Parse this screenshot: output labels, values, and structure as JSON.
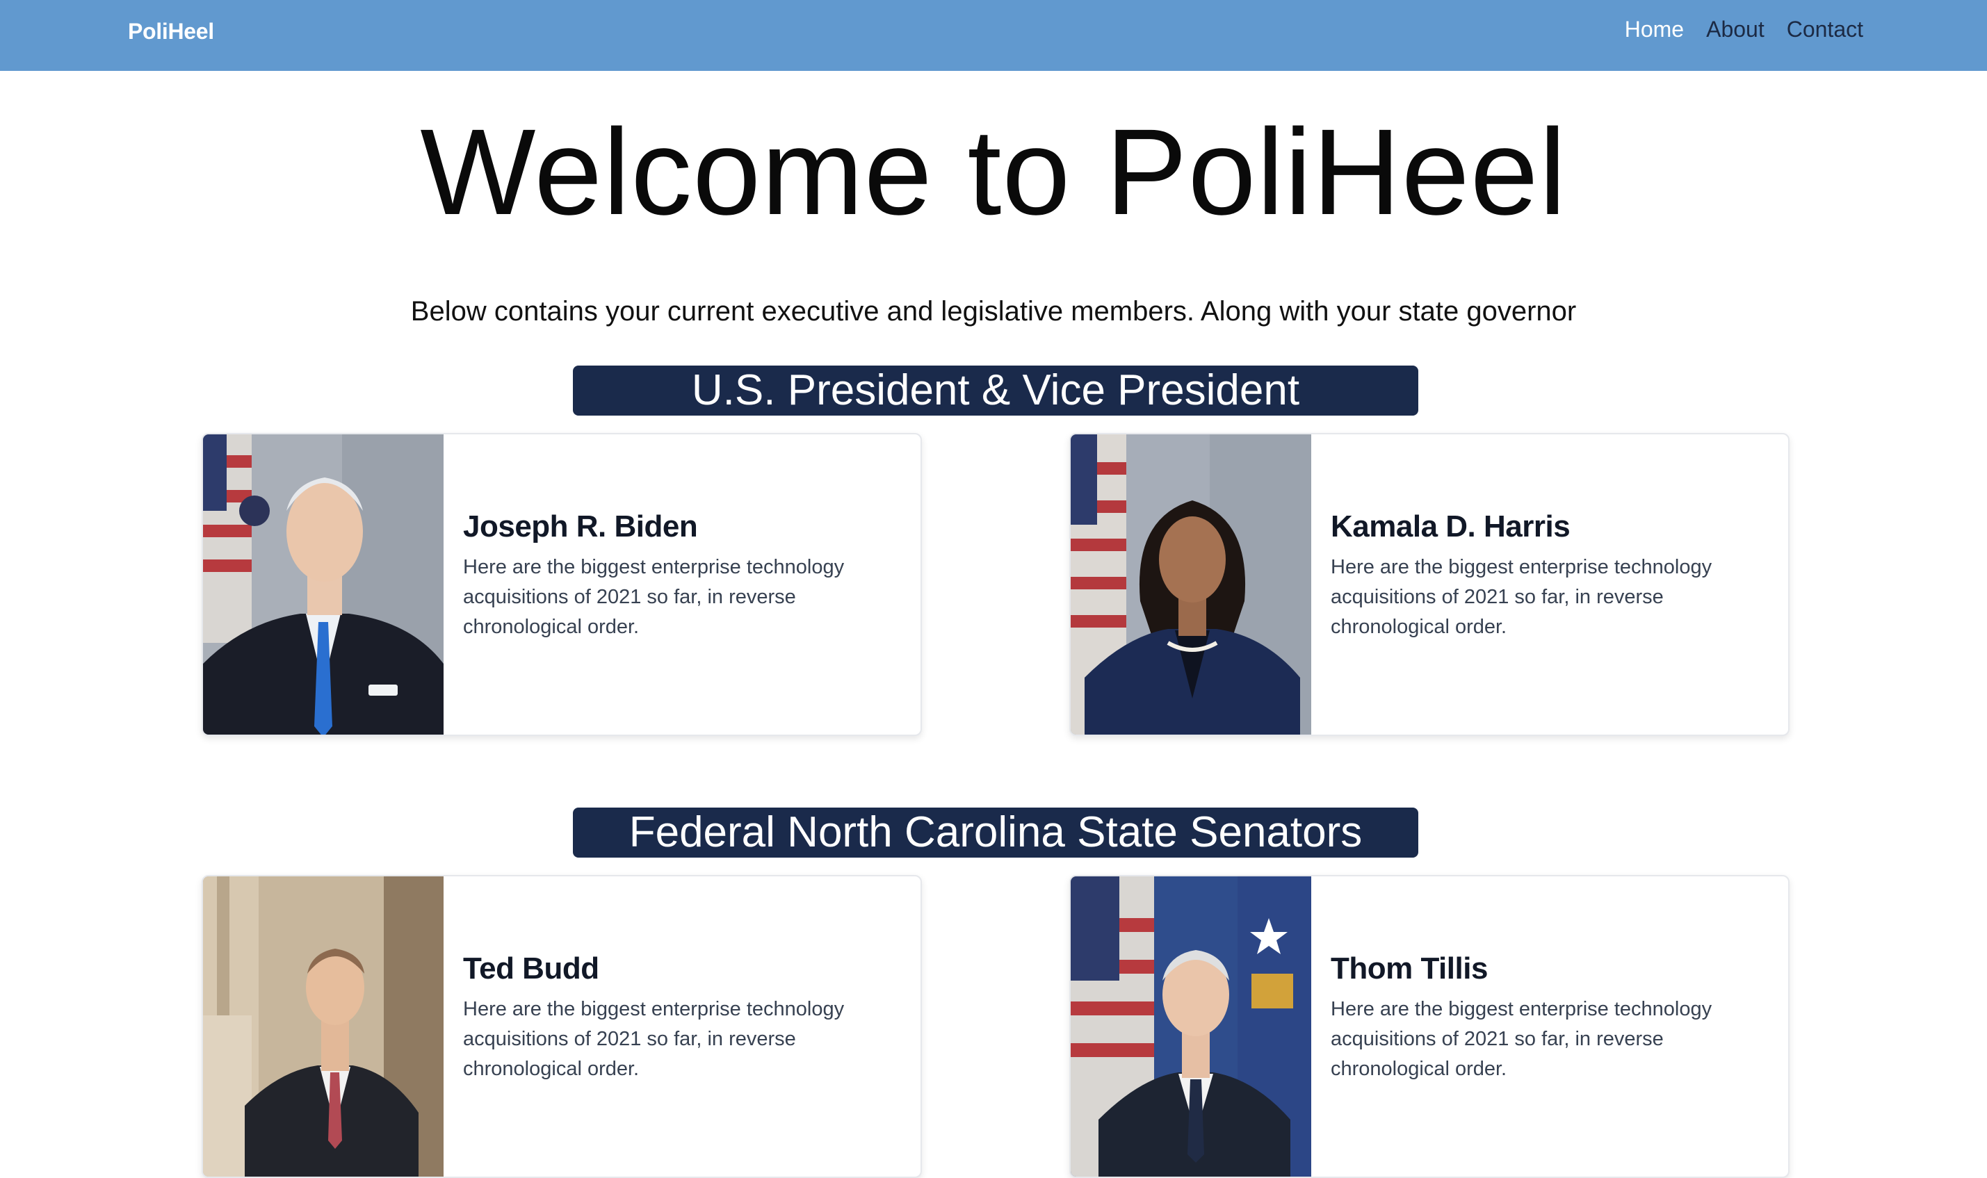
{
  "nav": {
    "brand": "PoliHeel",
    "links": [
      "Home",
      "About",
      "Contact"
    ]
  },
  "hero": {
    "title": "Welcome to PoliHeel",
    "subtitle": "Below contains your current executive and legislative members. Along with your state governor"
  },
  "sections": [
    {
      "title": "U.S. President & Vice President",
      "cards": [
        {
          "name": "Joseph R. Biden",
          "description": "Here are the biggest enterprise technology acquisitions of 2021 so far, in reverse chronological order."
        },
        {
          "name": "Kamala D. Harris",
          "description": "Here are the biggest enterprise technology acquisitions of 2021 so far, in reverse chronological order."
        }
      ]
    },
    {
      "title": "Federal North Carolina State Senators",
      "cards": [
        {
          "name": "Ted Budd",
          "description": "Here are the biggest enterprise technology acquisitions of 2021 so far, in reverse chronological order."
        },
        {
          "name": "Thom Tillis",
          "description": "Here are the biggest enterprise technology acquisitions of 2021 so far, in reverse chronological order."
        }
      ]
    }
  ],
  "colors": {
    "navbar": "#6199cf",
    "banner": "#1a2a4b",
    "nav_active": "#ffffff",
    "nav_link": "#1c2a44"
  }
}
